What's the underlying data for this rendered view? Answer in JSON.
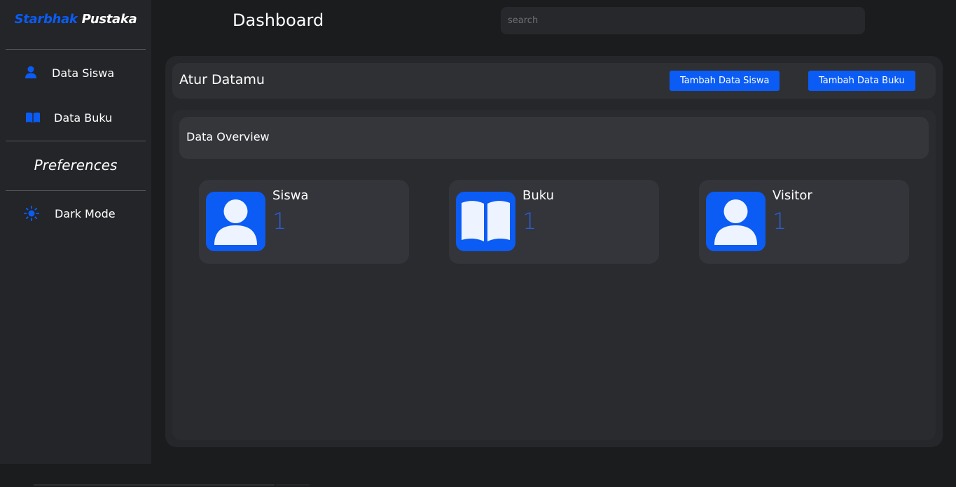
{
  "sidebar": {
    "brand_part1": "Starbhak",
    "brand_part2": "Pustaka",
    "items": [
      {
        "label": "Data Siswa",
        "icon": "user-icon"
      },
      {
        "label": "Data Buku",
        "icon": "book-icon"
      }
    ],
    "preferences_heading": "Preferences",
    "preference_items": [
      {
        "label": "Dark Mode",
        "icon": "sun-icon"
      }
    ]
  },
  "header": {
    "title": "Dashboard",
    "search_placeholder": "search"
  },
  "manage": {
    "title": "Atur Datamu",
    "add_student_label": "Tambah Data Siswa",
    "add_book_label": "Tambah Data Buku"
  },
  "overview": {
    "title": "Data Overview",
    "cards": [
      {
        "label": "Siswa",
        "count": "1",
        "icon": "user-icon"
      },
      {
        "label": "Buku",
        "count": "1",
        "icon": "book-icon"
      },
      {
        "label": "Visitor",
        "count": "1",
        "icon": "user-icon"
      }
    ]
  },
  "colors": {
    "accent": "#0a5cf5",
    "background": "#1b1c1e",
    "sidebar": "#242528",
    "panel": "#26272a",
    "count_text": "#2a5fd8"
  }
}
